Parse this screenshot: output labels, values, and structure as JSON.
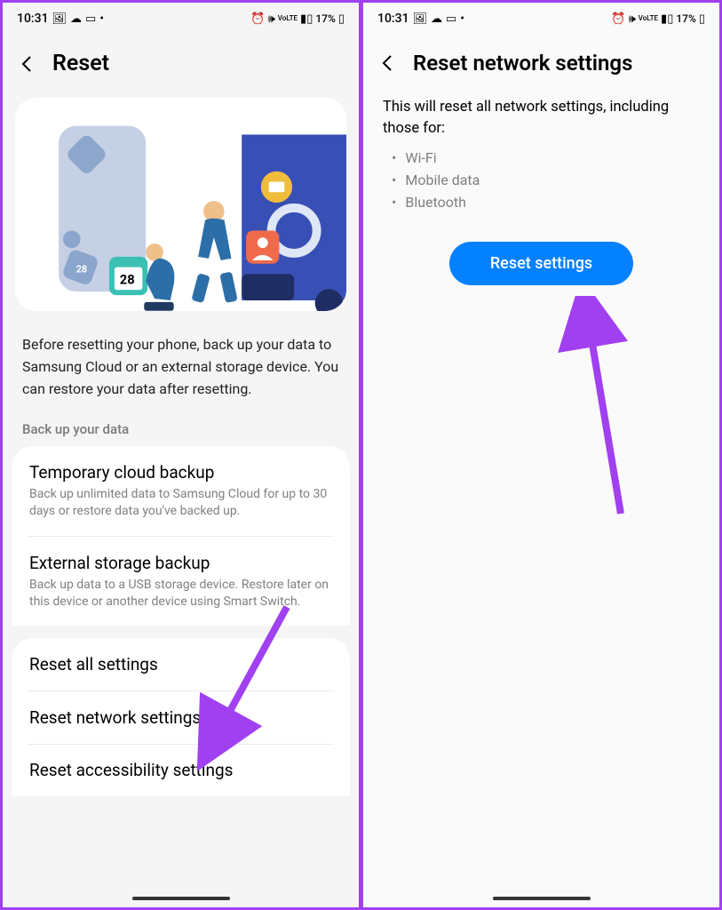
{
  "status": {
    "time": "10:31",
    "icons_left": [
      "img-icon",
      "cloud-icon",
      "book-icon",
      "dot-icon"
    ],
    "icons_right": [
      "alarm-icon",
      "wifi-icon",
      "volte-icon",
      "signal-icon"
    ],
    "battery_pct": "17%"
  },
  "left": {
    "title": "Reset",
    "intro": "Before resetting your phone, back up your data to Samsung Cloud or an external storage device. You can restore your data after resetting.",
    "section_label": "Back up your data",
    "backup": [
      {
        "title": "Temporary cloud backup",
        "sub": "Back up unlimited data to Samsung Cloud for up to 30 days or restore data you've backed up."
      },
      {
        "title": "External storage backup",
        "sub": "Back up data to a USB storage device. Restore later on this device or another device using Smart Switch."
      }
    ],
    "reset": [
      {
        "title": "Reset all settings"
      },
      {
        "title": "Reset network settings"
      },
      {
        "title": "Reset accessibility settings"
      }
    ]
  },
  "right": {
    "title": "Reset network settings",
    "desc": "This will reset all network settings, including those for:",
    "bullets": [
      "Wi-Fi",
      "Mobile data",
      "Bluetooth"
    ],
    "button": "Reset settings"
  },
  "arrow_color": "#a040f0"
}
